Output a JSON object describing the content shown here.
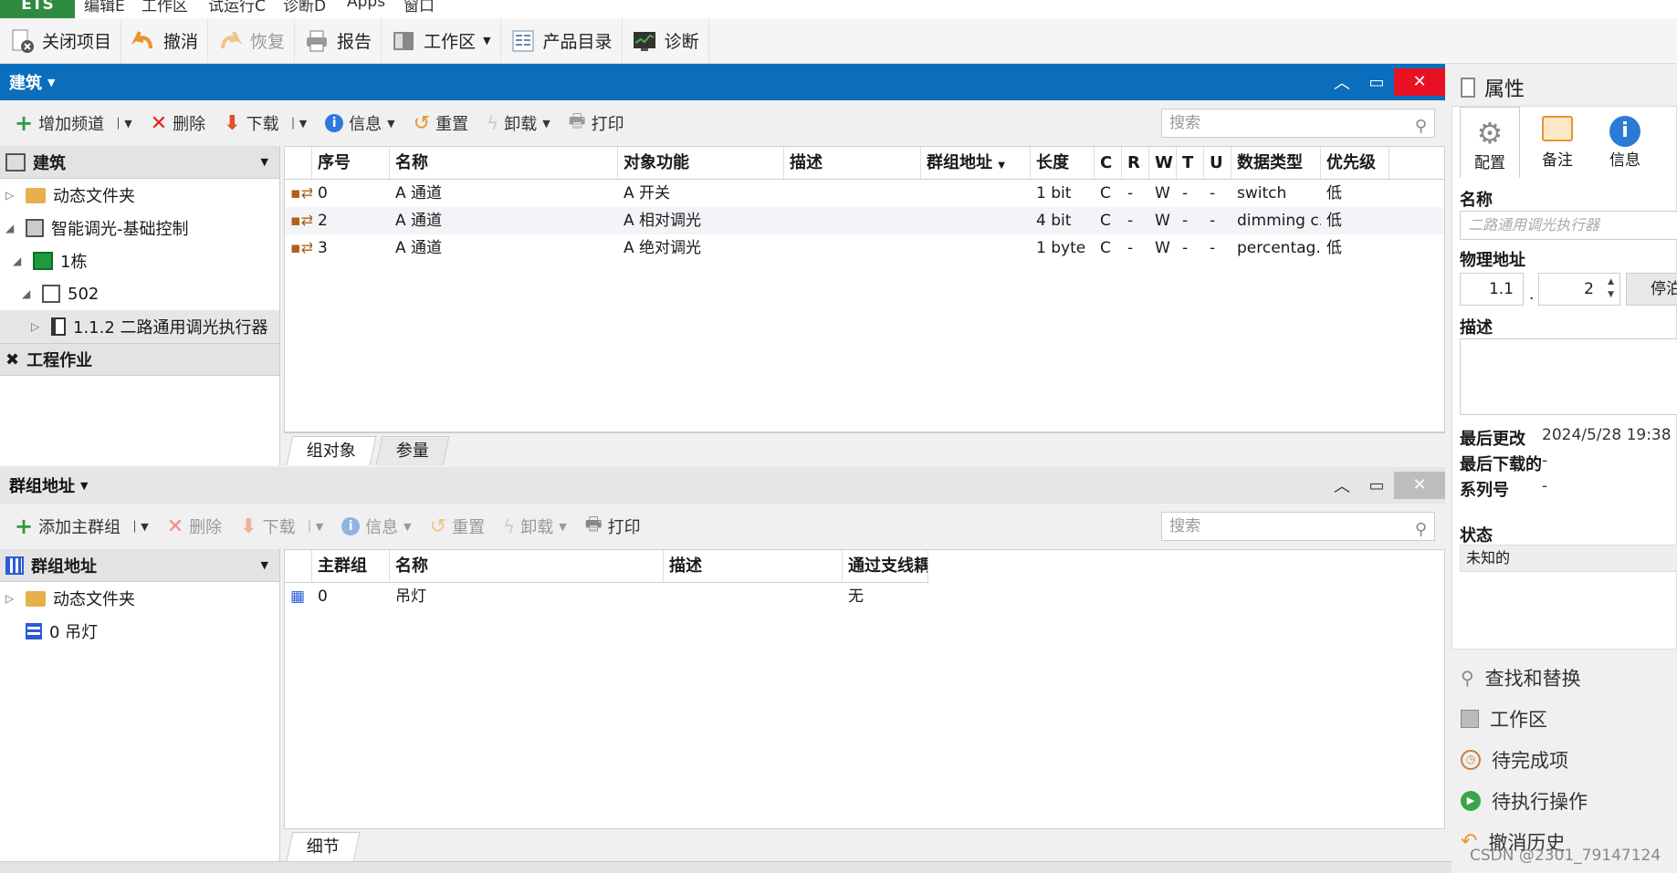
{
  "menubar": {
    "app_tab": "ETS",
    "items": [
      "编辑E",
      "工作区",
      "试运行C",
      "诊断D",
      "Apps",
      "窗口"
    ]
  },
  "toolbar": {
    "close_project": "关闭项目",
    "undo": "撤消",
    "redo": "恢复",
    "report": "报告",
    "workspace": "工作区",
    "catalog": "产品目录",
    "diagnostics": "诊断"
  },
  "building_panel": {
    "title": "建筑",
    "toolbar": {
      "add_channel": "增加频道",
      "delete": "删除",
      "download": "下载",
      "info": "信息",
      "reset": "重置",
      "unload": "卸载",
      "print": "打印",
      "search_placeholder": "搜索"
    },
    "tree": {
      "header": "建筑",
      "items": [
        "动态文件夹",
        "智能调光-基础控制",
        "1栋",
        "502",
        "1.1.2 二路通用调光执行器"
      ],
      "footer": "工程作业"
    },
    "table": {
      "columns": [
        "序号",
        "名称",
        "对象功能",
        "描述",
        "群组地址",
        "长度",
        "C",
        "R",
        "W",
        "T",
        "U",
        "数据类型",
        "优先级"
      ],
      "rows": [
        [
          "0",
          "A 通道",
          "A 开关",
          "",
          "",
          "1 bit",
          "C",
          "-",
          "W",
          "-",
          "-",
          "switch",
          "低"
        ],
        [
          "2",
          "A 通道",
          "A 相对调光",
          "",
          "",
          "4 bit",
          "C",
          "-",
          "W",
          "-",
          "-",
          "dimming c...",
          "低"
        ],
        [
          "3",
          "A 通道",
          "A 绝对调光",
          "",
          "",
          "1 byte",
          "C",
          "-",
          "W",
          "-",
          "-",
          "percentag...",
          "低"
        ]
      ]
    },
    "tabs": [
      "组对象",
      "参量"
    ]
  },
  "group_panel": {
    "title": "群组地址",
    "toolbar": {
      "add_main_group": "添加主群组",
      "delete": "删除",
      "download": "下载",
      "info": "信息",
      "reset": "重置",
      "unload": "卸载",
      "print": "打印",
      "search_placeholder": "搜索"
    },
    "tree": {
      "header": "群组地址",
      "items": [
        "动态文件夹",
        "0 吊灯"
      ]
    },
    "table": {
      "columns": [
        "主群组",
        "名称",
        "描述",
        "通过支线耦"
      ],
      "rows": [
        [
          "0",
          "吊灯",
          "",
          "无"
        ]
      ]
    },
    "tabs": [
      "细节"
    ]
  },
  "properties": {
    "title": "属性",
    "tabs": [
      "配置",
      "备注",
      "信息"
    ],
    "name_label": "名称",
    "name_placeholder": "二路通用调光执行器",
    "phys_addr_label": "物理地址",
    "phys_addr_prefix": "1.1",
    "phys_addr_dot": ".",
    "phys_addr_value": "2",
    "park_button": "停泊",
    "desc_label": "描述",
    "last_modified_label": "最后更改",
    "last_modified_value": "2024/5/28 19:38",
    "last_download_label": "最后下载的",
    "last_download_value": "-",
    "serial_label": "系列号",
    "serial_value": "-",
    "status_label": "状态",
    "status_value": "未知的",
    "links": [
      "查找和替换",
      "工作区",
      "待完成项",
      "待执行操作",
      "撤消历史"
    ]
  },
  "watermark": "CSDN @2301_79147124",
  "colors": {
    "accent_blue": "#0a6ebd",
    "ets_green": "#2e8b3e",
    "close_red": "#e81123"
  }
}
